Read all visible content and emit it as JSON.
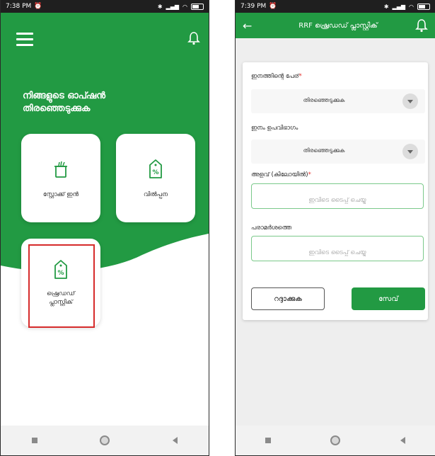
{
  "left": {
    "status": {
      "time": "7:38 PM"
    },
    "heading": "നിങ്ങളുടെ ഓപ്ഷൻ തിരഞ്ഞെടുക്കുക",
    "tiles": {
      "stock_in": "സ്റ്റോക്ക് ഇൻ",
      "sales": "വിൽപ്പന",
      "shredded_plastic_line1": "ഷ്രെഡഡ്",
      "shredded_plastic_line2": "പ്ലാസ്റ്റിക്"
    }
  },
  "right": {
    "status": {
      "time": "7:39 PM"
    },
    "title": "RRF ഷ്രെഡഡ് പ്ലാസ്റ്റിക്",
    "fields": {
      "item_name_label": "ഇനത്തിന്റെ പേര്",
      "item_name_value": "തിരഞ്ഞെടുക്കുക",
      "subcategory_label": "ഇനം ഉപവിഭാഗം",
      "subcategory_value": "തിരഞ്ഞെടുക്കുക",
      "quantity_label": "അളവ് (കിലോയിൽ)",
      "quantity_placeholder": "ഇവിടെ ടൈപ്പ് ചെയ്യൂ",
      "remarks_label": "പരാമർശത്തെ",
      "remarks_placeholder": "ഇവിടെ ടൈപ്പ് ചെയ്യൂ",
      "required_mark": "*"
    },
    "buttons": {
      "cancel": "റദ്ദാക്കുക",
      "save": "സേവ്"
    }
  },
  "colors": {
    "brand_green": "#229a43",
    "highlight_red": "#d62b2b"
  }
}
